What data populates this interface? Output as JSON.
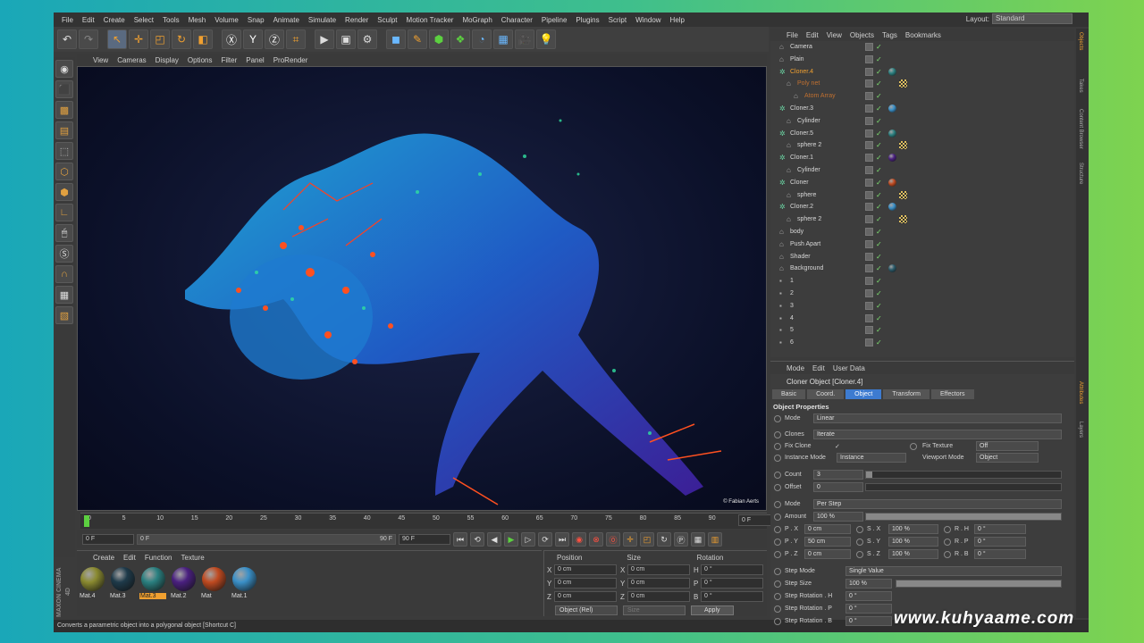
{
  "menu": [
    "File",
    "Edit",
    "Create",
    "Select",
    "Tools",
    "Mesh",
    "Volume",
    "Snap",
    "Animate",
    "Simulate",
    "Render",
    "Sculpt",
    "Motion Tracker",
    "MoGraph",
    "Character",
    "Pipeline",
    "Plugins",
    "Script",
    "Window",
    "Help"
  ],
  "layout": {
    "label": "Layout:",
    "value": "Standard"
  },
  "viewport": {
    "menu": [
      "View",
      "Cameras",
      "Display",
      "Options",
      "Filter",
      "Panel",
      "ProRender"
    ],
    "credit": "© Fabian Aerts"
  },
  "timeline": {
    "ticks": [
      "0",
      "5",
      "10",
      "15",
      "20",
      "25",
      "30",
      "35",
      "40",
      "45",
      "50",
      "55",
      "60",
      "65",
      "70",
      "75",
      "80",
      "85",
      "90"
    ],
    "current": "0 F",
    "start": "0 F",
    "end": "90 F",
    "range_start": "0 F",
    "range_end": "90 F"
  },
  "materials": {
    "menu": [
      "Create",
      "Edit",
      "Function",
      "Texture"
    ],
    "items": [
      {
        "name": "Mat.4",
        "color": "#8a8a30"
      },
      {
        "name": "Mat.3",
        "color": "#1e3a4a"
      },
      {
        "name": "Mat.3",
        "color": "#2a8080",
        "selected": true
      },
      {
        "name": "Mat.2",
        "color": "#4a2080"
      },
      {
        "name": "Mat",
        "color": "#c04a20"
      },
      {
        "name": "Mat.1",
        "color": "#3a90c8"
      }
    ]
  },
  "coords": {
    "headers": [
      "Position",
      "Size",
      "Rotation"
    ],
    "rows": [
      {
        "a1": "X",
        "v1": "0 cm",
        "a2": "X",
        "v2": "0 cm",
        "a3": "H",
        "v3": "0 °"
      },
      {
        "a1": "Y",
        "v1": "0 cm",
        "a2": "Y",
        "v2": "0 cm",
        "a3": "P",
        "v3": "0 °"
      },
      {
        "a1": "Z",
        "v1": "0 cm",
        "a2": "Z",
        "v2": "0 cm",
        "a3": "B",
        "v3": "0 °"
      }
    ],
    "mode": "Object (Rel)",
    "size": "Size",
    "apply": "Apply"
  },
  "status": "Converts a parametric object into a polygonal object [Shortcut C]",
  "brand": "MAXON CINEMA 4D",
  "objects": {
    "menu": [
      "File",
      "Edit",
      "View",
      "Objects",
      "Tags",
      "Bookmarks"
    ],
    "items": [
      {
        "name": "Camera",
        "indent": 0,
        "style": ""
      },
      {
        "name": "Plain",
        "indent": 0,
        "style": ""
      },
      {
        "name": "Cloner.4",
        "indent": 0,
        "style": "hl"
      },
      {
        "name": "Poly net",
        "indent": 1,
        "style": "dim"
      },
      {
        "name": "Atom Array",
        "indent": 2,
        "style": "dim"
      },
      {
        "name": "Cloner.3",
        "indent": 0,
        "style": ""
      },
      {
        "name": "Cylinder",
        "indent": 1,
        "style": ""
      },
      {
        "name": "Cloner.5",
        "indent": 0,
        "style": ""
      },
      {
        "name": "sphere 2",
        "indent": 1,
        "style": ""
      },
      {
        "name": "Cloner.1",
        "indent": 0,
        "style": ""
      },
      {
        "name": "Cylinder",
        "indent": 1,
        "style": ""
      },
      {
        "name": "Cloner",
        "indent": 0,
        "style": ""
      },
      {
        "name": "sphere",
        "indent": 1,
        "style": ""
      },
      {
        "name": "Cloner.2",
        "indent": 0,
        "style": ""
      },
      {
        "name": "sphere 2",
        "indent": 1,
        "style": ""
      },
      {
        "name": "body",
        "indent": 0,
        "style": ""
      },
      {
        "name": "Push Apart",
        "indent": 0,
        "style": ""
      },
      {
        "name": "Shader",
        "indent": 0,
        "style": ""
      },
      {
        "name": "Background",
        "indent": 0,
        "style": ""
      },
      {
        "name": "1",
        "indent": 0,
        "style": ""
      },
      {
        "name": "2",
        "indent": 0,
        "style": ""
      },
      {
        "name": "3",
        "indent": 0,
        "style": ""
      },
      {
        "name": "4",
        "indent": 0,
        "style": ""
      },
      {
        "name": "5",
        "indent": 0,
        "style": ""
      },
      {
        "name": "6",
        "indent": 0,
        "style": ""
      }
    ]
  },
  "sidetabs": [
    "Objects",
    "Takes",
    "Content Browser",
    "Structure",
    "Attributes",
    "Layers"
  ],
  "attributes": {
    "menu": [
      "Mode",
      "Edit",
      "User Data"
    ],
    "title": "Cloner Object [Cloner.4]",
    "tabs": [
      "Basic",
      "Coord.",
      "Object",
      "Transform",
      "Effectors"
    ],
    "section": "Object Properties",
    "mode_label": "Mode",
    "mode_value": "Linear",
    "clones_label": "Clones",
    "clones_value": "Iterate",
    "fixclone_label": "Fix Clone",
    "fixtex_label": "Fix Texture",
    "fixtex_value": "Off",
    "instmode_label": "Instance Mode",
    "instmode_value": "Instance",
    "vpmode_label": "Viewport Mode",
    "vpmode_value": "Object",
    "count_label": "Count",
    "count_value": "3",
    "offset_label": "Offset",
    "offset_value": "0",
    "mode2_label": "Mode",
    "mode2_value": "Per Step",
    "amount_label": "Amount",
    "amount_value": "100 %",
    "px_label": "P . X",
    "px": "0 cm",
    "sx_label": "S . X",
    "sx": "100 %",
    "rh_label": "R . H",
    "rh": "0 °",
    "py_label": "P . Y",
    "py": "50 cm",
    "sy_label": "S . Y",
    "sy": "100 %",
    "rp_label": "R . P",
    "rp": "0 °",
    "pz_label": "P . Z",
    "pz": "0 cm",
    "sz_label": "S . Z",
    "sz": "100 %",
    "rb_label": "R . B",
    "rb": "0 °",
    "stepmode_label": "Step Mode",
    "stepmode_value": "Single Value",
    "stepsize_label": "Step Size",
    "stepsize_value": "100 %",
    "steprotH_label": "Step Rotation . H",
    "steprotH_value": "0 °",
    "steprotP_label": "Step Rotation . P",
    "steprotP_value": "0 °",
    "steprotB_label": "Step Rotation . B",
    "steprotB_value": "0 °"
  },
  "watermark": "www.kuhyaame.com"
}
